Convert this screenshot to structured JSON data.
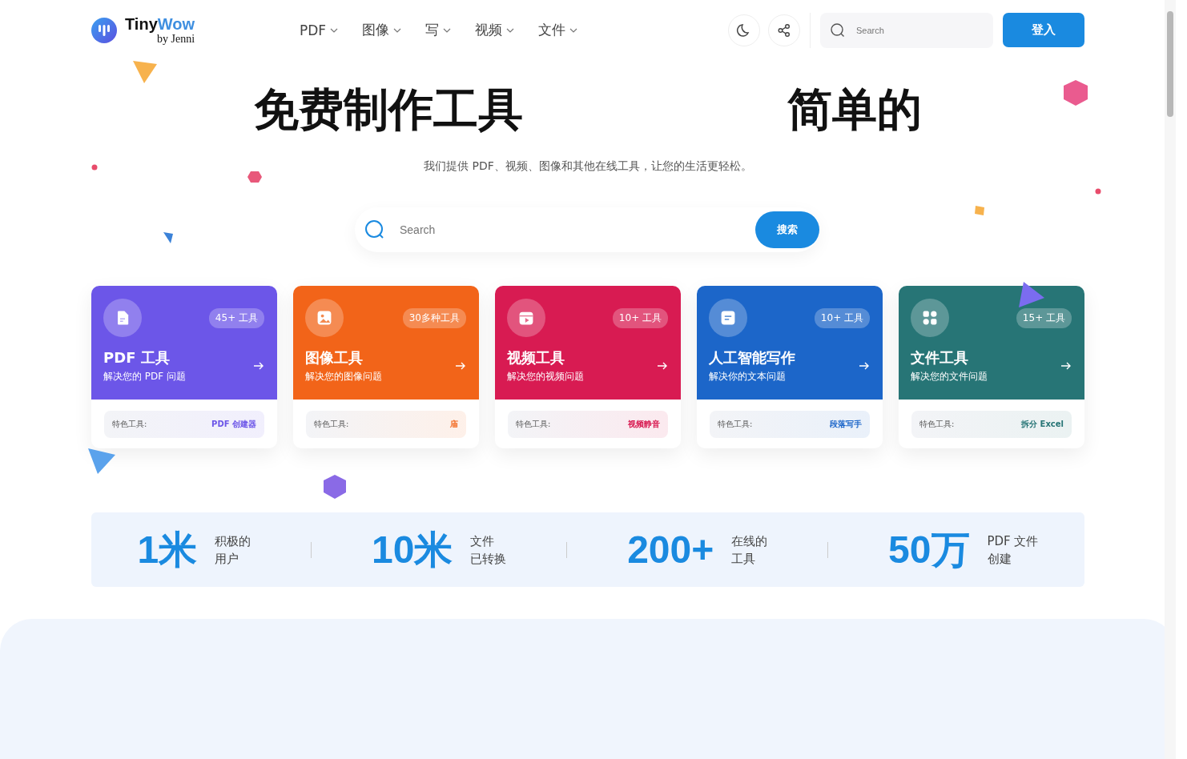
{
  "logo": {
    "name": "Tiny",
    "name_accent": "Wow",
    "byline": "by Jenni"
  },
  "nav": [
    {
      "label": "PDF"
    },
    {
      "label": "图像"
    },
    {
      "label": "写"
    },
    {
      "label": "视频"
    },
    {
      "label": "文件"
    }
  ],
  "header_search": {
    "placeholder": "Search"
  },
  "login_button": "登入",
  "hero": {
    "title_left": "免费制作工具",
    "title_right": "简单的",
    "subtitle": "我们提供 PDF、视频、图像和其他在线工具，让您的生活更轻松。"
  },
  "search": {
    "placeholder": "Search",
    "button": "搜索"
  },
  "categories": [
    {
      "kind": "pdf",
      "color": "#6c56e8",
      "badge": "45+ 工具",
      "title": "PDF 工具",
      "subtitle": "解决您的 PDF 问题",
      "featured_label": "特色工具:",
      "featured": "PDF 创建器"
    },
    {
      "kind": "image",
      "color": "#f26419",
      "badge": "30多种工具",
      "title": "图像工具",
      "subtitle": "解决您的图像问题",
      "featured_label": "特色工具:",
      "featured": "庙"
    },
    {
      "kind": "video",
      "color": "#d81b52",
      "badge": "10+ 工具",
      "title": "视频工具",
      "subtitle": "解决您的视频问题",
      "featured_label": "特色工具:",
      "featured": "视频静音"
    },
    {
      "kind": "write",
      "color": "#1c66c9",
      "badge": "10+ 工具",
      "title": "人工智能写作",
      "subtitle": "解决你的文本问题",
      "featured_label": "特色工具:",
      "featured": "段落写手"
    },
    {
      "kind": "file",
      "color": "#277576",
      "badge": "15+ 工具",
      "title": "文件工具",
      "subtitle": "解决您的文件问题",
      "featured_label": "特色工具:",
      "featured": "拆分 Excel"
    }
  ],
  "stats": [
    {
      "value": "1米",
      "label_lines": [
        "积极的",
        "用户"
      ]
    },
    {
      "value": "10米",
      "label_lines": [
        "文件",
        "已转换"
      ]
    },
    {
      "value": "200+",
      "label_lines": [
        "在线的",
        "工具"
      ]
    },
    {
      "value": "50万",
      "label_lines": [
        "PDF 文件",
        "创建"
      ]
    }
  ]
}
